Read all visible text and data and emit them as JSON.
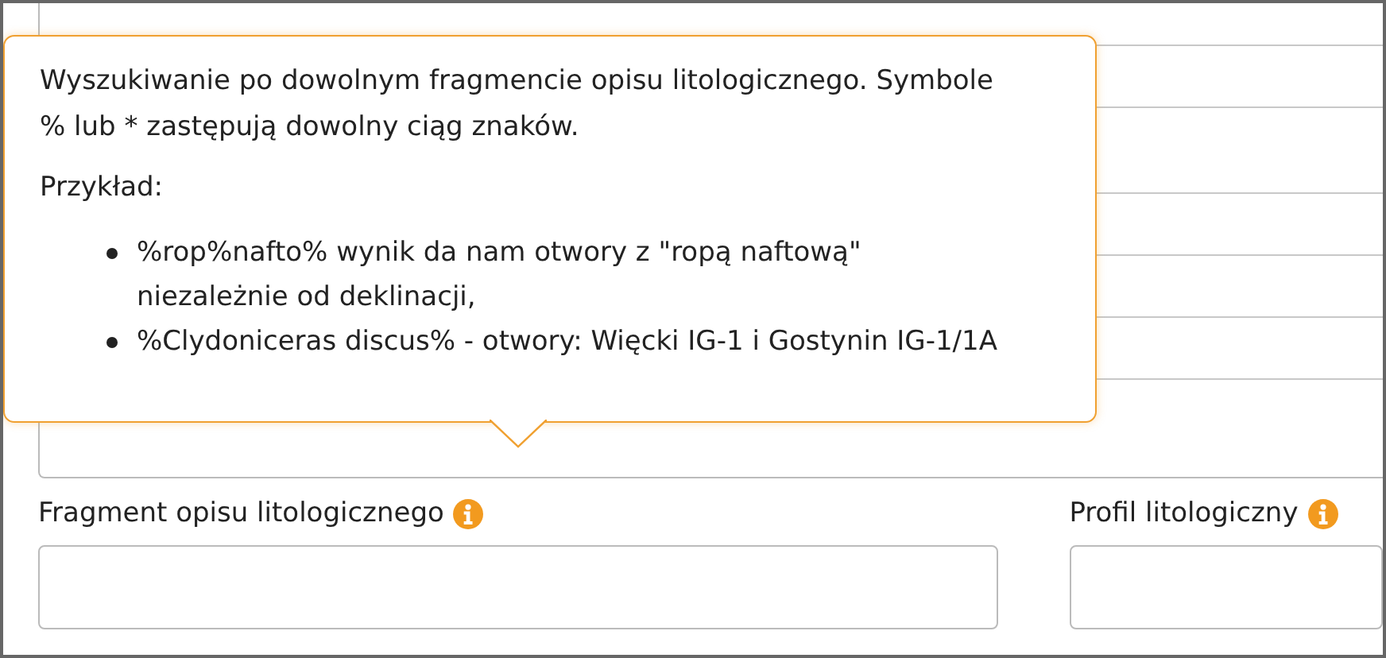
{
  "tooltip": {
    "paragraph": "Wyszukiwanie po dowolnym fragmencie opisu litologicznego. Symbole % lub * zastępują dowolny ciąg znaków.",
    "example_label": "Przykład:",
    "examples": [
      "%rop%nafto% wynik da nam otwory z \"ropą naftową\"\nniezależnie od deklinacji,",
      "%Clydoniceras discus% - otwory: Więcki IG-1 i Gostynin IG-1/1A"
    ]
  },
  "fields": [
    {
      "label": "Fragment opisu litologicznego"
    },
    {
      "label": "Profil litologiczny"
    }
  ]
}
